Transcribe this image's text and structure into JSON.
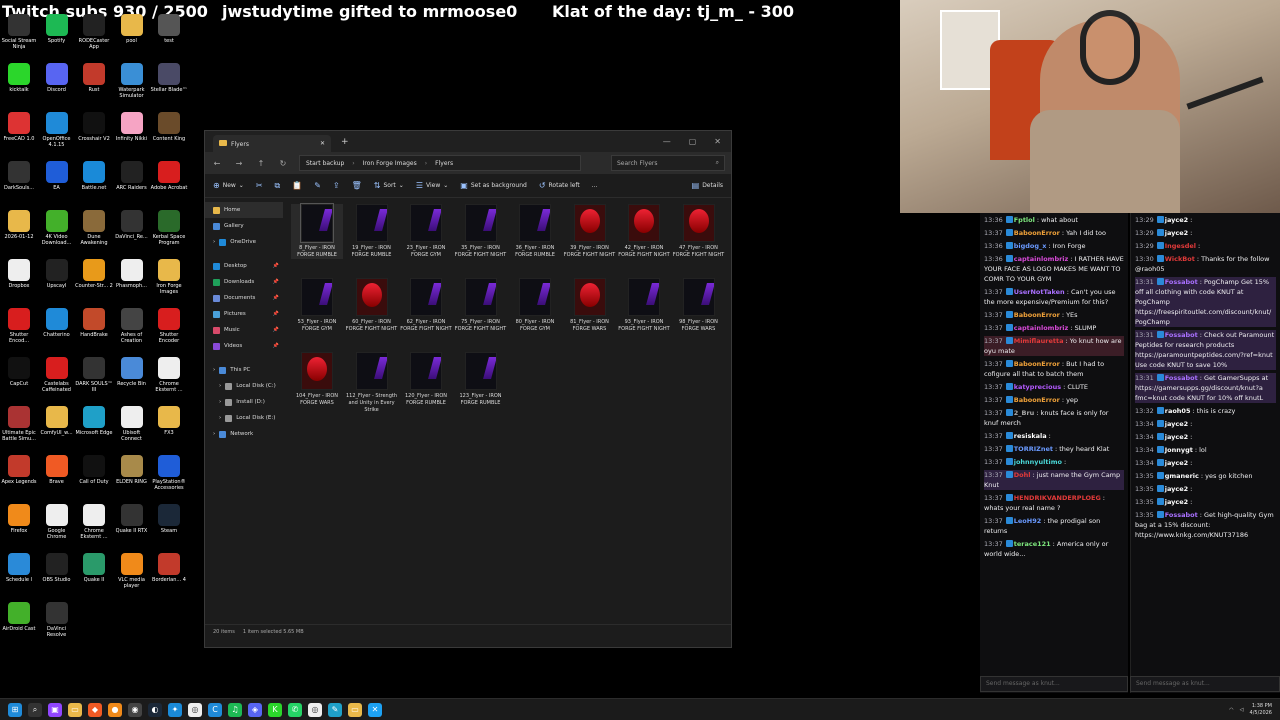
{
  "overlay": {
    "subs": "Twitch subs 930 / 2500",
    "gift": "jwstudytime gifted to mrmoose0",
    "klat": "Klat of the day: tj_m_ - 300"
  },
  "desktop_icons": [
    {
      "label": "Social Stream Ninja",
      "icon": "ninja-icon",
      "color": "#333"
    },
    {
      "label": "Spotify",
      "icon": "spotify-icon",
      "color": "#1db954"
    },
    {
      "label": "RODECaster App",
      "icon": "rode-icon",
      "color": "#222"
    },
    {
      "label": "pool",
      "icon": "folder-icon",
      "color": "#e8b84a"
    },
    {
      "label": "test",
      "icon": "folder-icon",
      "color": "#555"
    },
    {
      "label": "kicktalk",
      "icon": "kick-icon",
      "color": "#2bd62b"
    },
    {
      "label": "Discord",
      "icon": "discord-icon",
      "color": "#5865f2"
    },
    {
      "label": "Rust",
      "icon": "rust-icon",
      "color": "#c23a2b"
    },
    {
      "label": "Waterpark Simulator",
      "icon": "game-icon",
      "color": "#3a8fd6"
    },
    {
      "label": "Stellar Blade™",
      "icon": "game-icon",
      "color": "#4a4a66"
    },
    {
      "label": "FreeCAD 1.0",
      "icon": "freecad-icon",
      "color": "#d33"
    },
    {
      "label": "OpenOffice 4.1.15",
      "icon": "openoffice-icon",
      "color": "#1f8ad8"
    },
    {
      "label": "Crosshair V2",
      "icon": "crosshair-icon",
      "color": "#111"
    },
    {
      "label": "Infinity Nikki",
      "icon": "game-icon",
      "color": "#f6a4c4"
    },
    {
      "label": "Content King",
      "icon": "game-icon",
      "color": "#6a4b2a"
    },
    {
      "label": "DarkSouls...",
      "icon": "game-icon",
      "color": "#333"
    },
    {
      "label": "EA",
      "icon": "ea-icon",
      "color": "#1f5dd8"
    },
    {
      "label": "Battle.net",
      "icon": "battlenet-icon",
      "color": "#1a8ad8"
    },
    {
      "label": "ARC Raiders",
      "icon": "game-icon",
      "color": "#222"
    },
    {
      "label": "Adobe Acrobat",
      "icon": "acrobat-icon",
      "color": "#d81e1e"
    },
    {
      "label": "2026-01-12",
      "icon": "folder-icon",
      "color": "#e8b84a"
    },
    {
      "label": "4K Video Download...",
      "icon": "download-icon",
      "color": "#43b02a"
    },
    {
      "label": "Dune Awakening",
      "icon": "game-icon",
      "color": "#8a6a3a"
    },
    {
      "label": "DaVinci_Re...",
      "icon": "davinci-icon",
      "color": "#333"
    },
    {
      "label": "Kerbal Space Program",
      "icon": "game-icon",
      "color": "#2a6a2a"
    },
    {
      "label": "Dropbox",
      "icon": "file-icon",
      "color": "#eee"
    },
    {
      "label": "Upscayl",
      "icon": "upscayl-icon",
      "color": "#222"
    },
    {
      "label": "Counter-Str... 2",
      "icon": "cs-icon",
      "color": "#e89a1a"
    },
    {
      "label": "Phasmoph...",
      "icon": "game-icon",
      "color": "#eee"
    },
    {
      "label": "Iron Forge Images",
      "icon": "folder-icon",
      "color": "#e8b84a"
    },
    {
      "label": "Shutter Encod...",
      "icon": "shutter-icon",
      "color": "#d81e1e"
    },
    {
      "label": "Chatterino",
      "icon": "chatterino-icon",
      "color": "#1f8ad8"
    },
    {
      "label": "HandBrake",
      "icon": "handbrake-icon",
      "color": "#c24a2a"
    },
    {
      "label": "Ashes of Creation",
      "icon": "game-icon",
      "color": "#444"
    },
    {
      "label": "Shutter Encoder",
      "icon": "shutter-icon",
      "color": "#d81e1e"
    },
    {
      "label": "CapCut",
      "icon": "capcut-icon",
      "color": "#111"
    },
    {
      "label": "Castelabs Caffeinated",
      "icon": "castelabs-icon",
      "color": "#d81e1e"
    },
    {
      "label": "DARK SOULS™ III",
      "icon": "game-icon",
      "color": "#333"
    },
    {
      "label": "Recycle Bin",
      "icon": "recycle-bin-icon",
      "color": "#4a8ad8"
    },
    {
      "label": "Chrome Eksternt ...",
      "icon": "chrome-icon",
      "color": "#eee"
    },
    {
      "label": "Ultimate Epic Battle Simu...",
      "icon": "game-icon",
      "color": "#a33"
    },
    {
      "label": "ComfyUI_w...",
      "icon": "folder-icon",
      "color": "#e8b84a"
    },
    {
      "label": "Microsoft Edge",
      "icon": "edge-icon",
      "color": "#1fa0c8"
    },
    {
      "label": "Ubisoft Connect",
      "icon": "ubisoft-icon",
      "color": "#eee"
    },
    {
      "label": "FX3",
      "icon": "folder-icon",
      "color": "#e8b84a"
    },
    {
      "label": "Apex Legends",
      "icon": "apex-icon",
      "color": "#c23a2b"
    },
    {
      "label": "Brave",
      "icon": "brave-icon",
      "color": "#f05a24"
    },
    {
      "label": "Call of Duty",
      "icon": "cod-icon",
      "color": "#111"
    },
    {
      "label": "ELDEN RING",
      "icon": "game-icon",
      "color": "#a88a4a"
    },
    {
      "label": "PlayStation® Accessories",
      "icon": "playstation-icon",
      "color": "#1f5dd8"
    },
    {
      "label": "Firefox",
      "icon": "firefox-icon",
      "color": "#f08a1a"
    },
    {
      "label": "Google Chrome",
      "icon": "chrome-icon",
      "color": "#eee"
    },
    {
      "label": "Chrome Eksternt ...",
      "icon": "chrome-icon",
      "color": "#eee"
    },
    {
      "label": "Quake II RTX",
      "icon": "game-icon",
      "color": "#333"
    },
    {
      "label": "Steam",
      "icon": "steam-icon",
      "color": "#1b2838"
    },
    {
      "label": "Schedule I",
      "icon": "game-icon",
      "color": "#2a8ad8"
    },
    {
      "label": "OBS Studio",
      "icon": "obs-icon",
      "color": "#222"
    },
    {
      "label": "Quake II",
      "icon": "game-icon",
      "color": "#2a9a6a"
    },
    {
      "label": "VLC media player",
      "icon": "vlc-icon",
      "color": "#f08a1a"
    },
    {
      "label": "Borderlan... 4",
      "icon": "game-icon",
      "color": "#c23a2b"
    },
    {
      "label": "AirDroid Cast",
      "icon": "airdroid-icon",
      "color": "#43b02a"
    },
    {
      "label": "DaVinci Resolve",
      "icon": "davinci-icon",
      "color": "#333"
    }
  ],
  "explorer": {
    "tab_title": "Flyers",
    "close_glyph": "✕",
    "add_glyph": "+",
    "win_controls": [
      "—",
      "▢",
      "✕"
    ],
    "breadcrumb": [
      "Start backup",
      "Iron Forge Images",
      "Flyers"
    ],
    "breadcrumb_sep": "›",
    "search_placeholder": "Search Flyers",
    "commands": [
      {
        "label": "New",
        "icon": "new-icon",
        "sym": "⊕",
        "arrow": true
      },
      {
        "label": "",
        "icon": "cut-icon",
        "sym": "✂"
      },
      {
        "label": "",
        "icon": "copy-icon",
        "sym": "⧉"
      },
      {
        "label": "",
        "icon": "paste-icon",
        "sym": "📋"
      },
      {
        "label": "",
        "icon": "rename-icon",
        "sym": "✎"
      },
      {
        "label": "",
        "icon": "share-icon",
        "sym": "⇪"
      },
      {
        "label": "",
        "icon": "delete-icon",
        "sym": "🗑"
      },
      {
        "label": "Sort",
        "icon": "sort-icon",
        "sym": "⇅",
        "arrow": true
      },
      {
        "label": "View",
        "icon": "view-icon",
        "sym": "☰",
        "arrow": true
      },
      {
        "label": "Set as background",
        "icon": "background-icon",
        "sym": "▣"
      },
      {
        "label": "Rotate left",
        "icon": "rotate-left-icon",
        "sym": "↺"
      },
      {
        "label": "...",
        "icon": "more-icon",
        "sym": ""
      }
    ],
    "details_label": "Details",
    "nav_items": [
      {
        "label": "Home",
        "icon": "home-icon",
        "color": "#e8b84a",
        "active": true
      },
      {
        "label": "Gallery",
        "icon": "gallery-icon",
        "color": "#4a8ad8"
      },
      {
        "label": "OneDrive",
        "icon": "onedrive-icon",
        "color": "#1f8ad8",
        "expand": true
      },
      {
        "gap": true
      },
      {
        "label": "Desktop",
        "icon": "desktop-icon",
        "color": "#1f8ad8",
        "pin": true
      },
      {
        "label": "Downloads",
        "icon": "downloads-icon",
        "color": "#1fa05a",
        "pin": true
      },
      {
        "label": "Documents",
        "icon": "documents-icon",
        "color": "#6a8ad8",
        "pin": true
      },
      {
        "label": "Pictures",
        "icon": "pictures-icon",
        "color": "#4aa0d8",
        "pin": true
      },
      {
        "label": "Music",
        "icon": "music-icon",
        "color": "#d84a6a",
        "pin": true
      },
      {
        "label": "Videos",
        "icon": "videos-icon",
        "color": "#8a4ad8",
        "pin": true
      },
      {
        "gap": true
      },
      {
        "label": "This PC",
        "icon": "this-pc-icon",
        "color": "#4a8ad8",
        "expand": true
      },
      {
        "label": "Local Disk (C:)",
        "icon": "disk-icon",
        "color": "#999",
        "expand": true,
        "indent": true
      },
      {
        "label": "Install (D:)",
        "icon": "disk-icon",
        "color": "#999",
        "expand": true,
        "indent": true
      },
      {
        "label": "Local Disk (E:)",
        "icon": "disk-icon",
        "color": "#999",
        "expand": true,
        "indent": true
      },
      {
        "label": "Network",
        "icon": "network-icon",
        "color": "#4a8ad8",
        "expand": true
      }
    ],
    "pin_glyph": "📌",
    "expand_glyph": "›",
    "files": [
      {
        "name": "8_Flyer - IRON FORGE RUMBLE",
        "thumb": "dark",
        "selected": true
      },
      {
        "name": "19_Flyer - IRON FORGE RUMBLE",
        "thumb": "dark"
      },
      {
        "name": "23_Flyer - IRON FORGE GYM",
        "thumb": "dark"
      },
      {
        "name": "35_Flyer - IRON FORGE FIGHT NIGHT",
        "thumb": "dark"
      },
      {
        "name": "36_Flyer - IRON FORGE RUMBLE",
        "thumb": "dark"
      },
      {
        "name": "39_Flyer - IRON FORGE FIGHT NIGHT",
        "thumb": "red"
      },
      {
        "name": "42_Flyer - IRON FORGE FIGHT NIGHT",
        "thumb": "red"
      },
      {
        "name": "47_Flyer - IRON FORGE FIGHT NIGHT",
        "thumb": "red"
      },
      {
        "name": "53_Flyer - IRON FORGE GYM",
        "thumb": "dark"
      },
      {
        "name": "60_Flyer - IRON FORGE FIGHT NIGHT",
        "thumb": "red"
      },
      {
        "name": "62_Flyer - IRON FORGE FIGHT NIGHT",
        "thumb": "dark"
      },
      {
        "name": "75_Flyer - IRON FORGE FIGHT NIGHT",
        "thumb": "dark"
      },
      {
        "name": "80_Flyer - IRON FORGE GYM",
        "thumb": "dark"
      },
      {
        "name": "81_Flyer - IRON FORGE WARS",
        "thumb": "red"
      },
      {
        "name": "93_Flyer - IRON FORGE FIGHT NIGHT",
        "thumb": "dark"
      },
      {
        "name": "98_Flyer - IRON FORGE WARS",
        "thumb": "dark"
      },
      {
        "name": "104_Flyer - IRON FORGE WARS",
        "thumb": "red"
      },
      {
        "name": "112_Flyer - Strength and Unity in Every Strike",
        "thumb": "dark"
      },
      {
        "name": "120_Flyer - IRON FORGE RUMBLE",
        "thumb": "dark"
      },
      {
        "name": "123_Flyer - IRON FORGE RUMBLE",
        "thumb": "dark"
      }
    ],
    "status": {
      "count": "20 items",
      "selection": "1 item selected 5.65 MB"
    }
  },
  "chat_left": [
    {
      "ts": "13:36",
      "user": "Fptlol",
      "color": "#7ee87e",
      "text": ": what about"
    },
    {
      "ts": "13:37",
      "user": "BaboonError",
      "color": "#f2a33a",
      "text": ": Yah I did too"
    },
    {
      "ts": "13:36",
      "user": "bigdog_x",
      "color": "#6a9aff",
      "text": ": Iron Forge"
    },
    {
      "ts": "13:36",
      "user": "captainlombriz",
      "color": "#d84ad8",
      "text": ": I RATHER HAVE YOUR FACE AS LOGO MAKES ME WANT TO COMR TO YOUR GYM"
    },
    {
      "ts": "13:37",
      "user": "UserNotTaken",
      "color": "#a970ff",
      "text": ": Can't you use the more expensive/Premium for this?"
    },
    {
      "ts": "13:37",
      "user": "BaboonError",
      "color": "#f2a33a",
      "text": ": YEs"
    },
    {
      "ts": "13:37",
      "user": "captainlombriz",
      "color": "#d84ad8",
      "text": ": SLUMP"
    },
    {
      "ts": "13:37",
      "user": "Mimiflauretta",
      "color": "#e23a3a",
      "text": ": Yo knut how are oyu mate",
      "hl": true
    },
    {
      "ts": "13:37",
      "user": "BaboonError",
      "color": "#f2a33a",
      "text": ": But I had to cofigure all that to batch them"
    },
    {
      "ts": "13:37",
      "user": "katyprecious",
      "color": "#b45aff",
      "text": ": CLUTE"
    },
    {
      "ts": "13:37",
      "user": "BaboonError",
      "color": "#f2a33a",
      "text": ": yep"
    },
    {
      "ts": "13:37",
      "user": "2_Bru",
      "color": "#aaa",
      "text": ": knuts face is only for knuf merch"
    },
    {
      "ts": "13:37",
      "user": "resiskala",
      "color": "#fff",
      "text": ":"
    },
    {
      "ts": "13:37",
      "user": "TORRIZnet",
      "color": "#6a9aff",
      "text": ": they heard Klat"
    },
    {
      "ts": "13:37",
      "user": "johnnyultimo",
      "color": "#4ad8d8",
      "text": ":"
    },
    {
      "ts": "13:37",
      "user": "Dohl",
      "color": "#e23a3a",
      "text": ": just name the Gym Camp Knut",
      "hl2": true
    },
    {
      "ts": "13:37",
      "user": "HENDRIKVANDERPLOEG",
      "color": "#e23a3a",
      "text": ": whats your real name ?"
    },
    {
      "ts": "13:37",
      "user": "LeoH92",
      "color": "#6a9aff",
      "text": ": the prodigal son returns"
    },
    {
      "ts": "13:37",
      "user": "terace121",
      "color": "#7ee87e",
      "text": ": America only or world wide..."
    }
  ],
  "chat_right": [
    {
      "ts": "13:29",
      "user": "jayce2",
      "color": "#fff",
      "text": ":"
    },
    {
      "ts": "13:29",
      "user": "jayce2",
      "color": "#fff",
      "text": ":"
    },
    {
      "ts": "13:29",
      "user": "Ingesdel",
      "color": "#e23a3a",
      "text": ":"
    },
    {
      "ts": "13:30",
      "user": "WickBot",
      "color": "#e23a3a",
      "text": ": Thanks for the follow @raoh05"
    },
    {
      "ts": "13:31",
      "user": "Fossabot",
      "color": "#a970ff",
      "text": ": PogChamp Get 15% off all clothing with code KNUT at PogChamp https://freespiritoutlet.com/discount/knut/ PogChamp",
      "hl2": true
    },
    {
      "ts": "13:31",
      "user": "Fossabot",
      "color": "#a970ff",
      "text": ": Check out Paramount Peptides for research products https://paramountpeptides.com/?ref=knut Use code KNUT to save 10%",
      "hl2": true
    },
    {
      "ts": "13:31",
      "user": "Fossabot",
      "color": "#a970ff",
      "text": ": Get GamerSupps at https://gamersupps.gg/discount/knut?a fmc=knut code KNUT for 10% off knutL",
      "hl2": true
    },
    {
      "ts": "13:32",
      "user": "raoh05",
      "color": "#fff",
      "text": ": this is crazy"
    },
    {
      "ts": "13:34",
      "user": "jayce2",
      "color": "#fff",
      "text": ":"
    },
    {
      "ts": "13:34",
      "user": "jayce2",
      "color": "#fff",
      "text": ":"
    },
    {
      "ts": "13:34",
      "user": "Jonnygt",
      "color": "#fff",
      "text": ": lol"
    },
    {
      "ts": "13:34",
      "user": "jayce2",
      "color": "#fff",
      "text": ":"
    },
    {
      "ts": "13:35",
      "user": "gmaneric",
      "color": "#fff",
      "text": ": yes go kitchen"
    },
    {
      "ts": "13:35",
      "user": "jayce2",
      "color": "#fff",
      "text": ":"
    },
    {
      "ts": "13:35",
      "user": "jayce2",
      "color": "#fff",
      "text": ":"
    },
    {
      "ts": "13:35",
      "user": "Fossabot",
      "color": "#a970ff",
      "text": ": Get high-quality Gym bag at a 15% discount: https://www.knkg.com/KNUT37186"
    }
  ],
  "chat_input_placeholder": "Send message as knut...",
  "taskbar": {
    "items": [
      {
        "icon": "windows-start-icon",
        "color": "#1f8ad8",
        "glyph": "⊞"
      },
      {
        "icon": "search-icon",
        "color": "#333",
        "glyph": "⌕"
      },
      {
        "icon": "twitch-icon",
        "color": "#9146ff",
        "glyph": "▣"
      },
      {
        "icon": "file-explorer-icon",
        "color": "#e8b84a",
        "glyph": "▭"
      },
      {
        "icon": "brave-icon",
        "color": "#f05a24",
        "glyph": "◆"
      },
      {
        "icon": "firefox-icon",
        "color": "#f08a1a",
        "glyph": "●"
      },
      {
        "icon": "obs-icon",
        "color": "#444",
        "glyph": "◉"
      },
      {
        "icon": "steam-icon",
        "color": "#1b2838",
        "glyph": "◐"
      },
      {
        "icon": "battlenet-icon",
        "color": "#1a8ad8",
        "glyph": "✦"
      },
      {
        "icon": "chrome-icon",
        "color": "#eee",
        "glyph": "◎"
      },
      {
        "icon": "chatterino-icon",
        "color": "#1f8ad8",
        "glyph": "C"
      },
      {
        "icon": "spotify-icon",
        "color": "#1db954",
        "glyph": "♫"
      },
      {
        "icon": "discord-icon",
        "color": "#5865f2",
        "glyph": "◈"
      },
      {
        "icon": "kick-icon",
        "color": "#2bd62b",
        "glyph": "K"
      },
      {
        "icon": "whatsapp-icon",
        "color": "#25d366",
        "glyph": "✆"
      },
      {
        "icon": "chrome-icon",
        "color": "#eee",
        "glyph": "◎"
      },
      {
        "icon": "notepad-icon",
        "color": "#1fa0c8",
        "glyph": "✎"
      },
      {
        "icon": "folder-icon",
        "color": "#e8b84a",
        "glyph": "▭"
      },
      {
        "icon": "twitter-icon",
        "color": "#1da1f2",
        "glyph": "✕"
      }
    ],
    "time": "1:38 PM",
    "date": "4/5/2026"
  }
}
